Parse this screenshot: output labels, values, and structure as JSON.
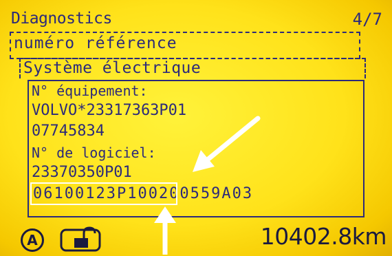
{
  "header": {
    "title": "Diagnostics",
    "page_counter": "4/7"
  },
  "menu": {
    "reference_label": "numéro référence",
    "system_label": "Système électrique"
  },
  "details": {
    "equipment_label": "N° équipement:",
    "equipment_code": "VOLVO*23317363P01",
    "equipment_serial": "07745834",
    "software_label": "N° de logiciel:",
    "software_code": "23370350P01",
    "software_serial": "06100123P100200559A03"
  },
  "footer": {
    "odometer": "10402.8km",
    "icons": [
      "autonomous-mode-a-icon",
      "unlocked-padlock-icon"
    ]
  },
  "colors": {
    "lcd_background": "#ffe21a",
    "lcd_text": "#2c2a7a",
    "annotation": "#ffffff"
  }
}
